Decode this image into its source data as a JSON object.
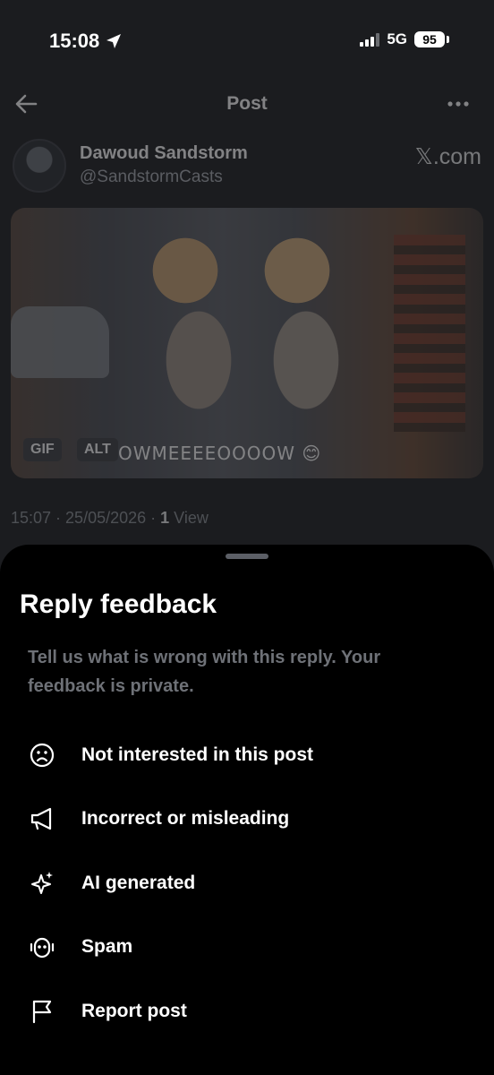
{
  "status_bar": {
    "time": "15:08",
    "network": "5G",
    "battery": "95"
  },
  "nav": {
    "title": "Post"
  },
  "post": {
    "author_name": "Dawoud Sandstorm",
    "author_handle": "@SandstormCasts",
    "brand": "𝕏.com",
    "media": {
      "gif_badge": "GIF",
      "alt_badge": "ALT",
      "caption": "OWMEEEEOOOOW 😊"
    },
    "time": "15:07",
    "date": "25/05/2026",
    "view_count": "1",
    "view_label": "View"
  },
  "sheet": {
    "title": "Reply feedback",
    "subtitle": "Tell us what is wrong with this reply. Your feedback is private.",
    "options": [
      {
        "label": "Not interested in this post",
        "icon": "frown-face-icon"
      },
      {
        "label": "Incorrect or misleading",
        "icon": "megaphone-icon"
      },
      {
        "label": "AI generated",
        "icon": "sparkle-icon"
      },
      {
        "label": "Spam",
        "icon": "robot-icon"
      },
      {
        "label": "Report post",
        "icon": "flag-icon"
      }
    ]
  }
}
